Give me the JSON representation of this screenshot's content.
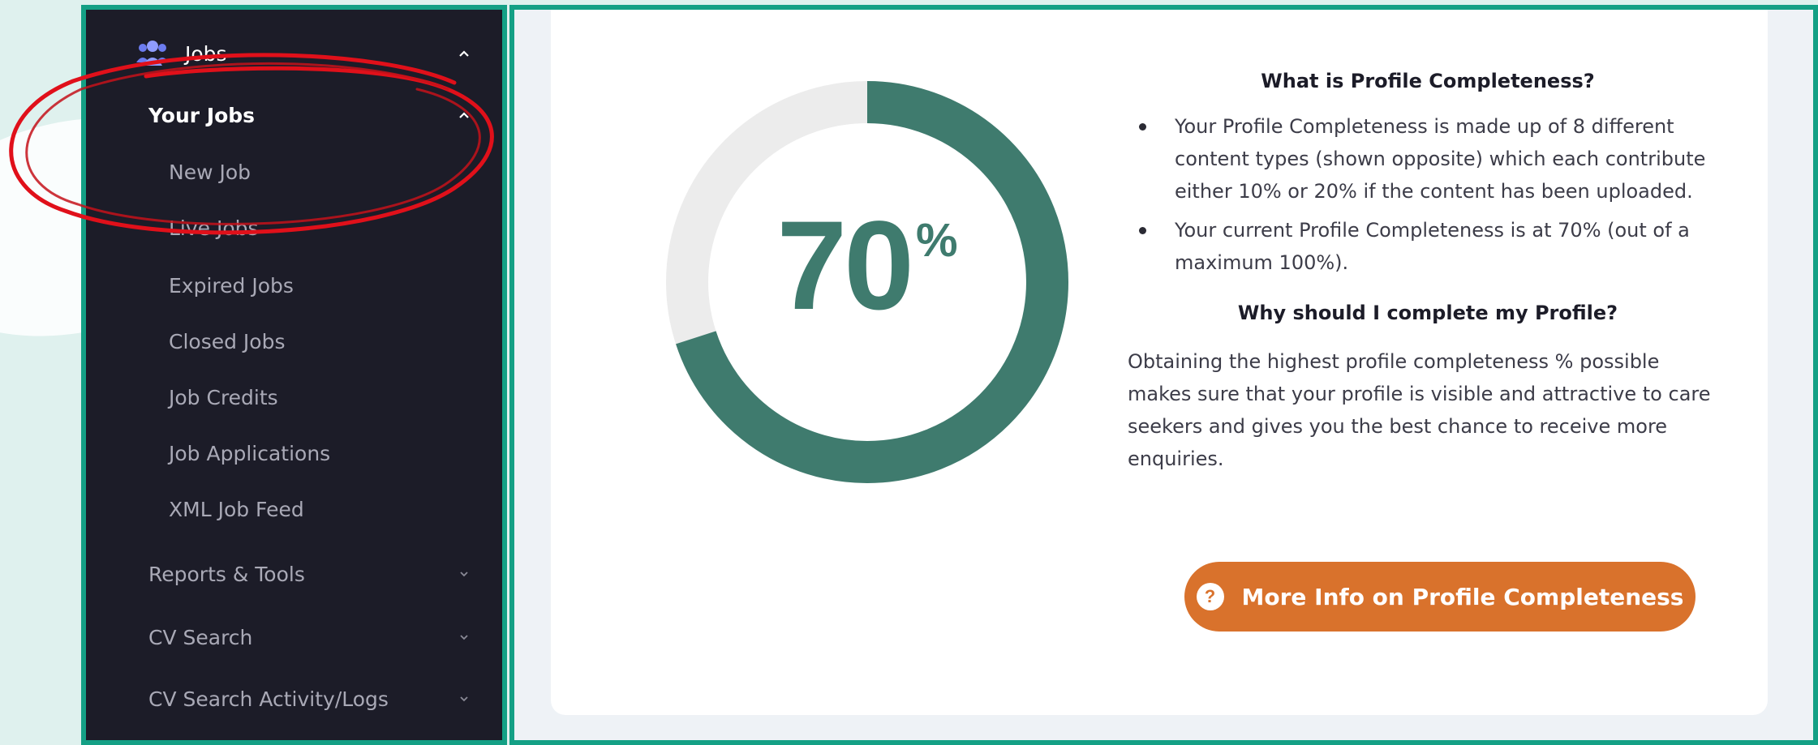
{
  "sidebar": {
    "section": {
      "label": "Jobs",
      "icon": "users-icon",
      "expanded": true
    },
    "items": [
      {
        "label": "Your Jobs",
        "level": "sub-parent",
        "active": true
      },
      {
        "label": "New Job"
      },
      {
        "label": "Live Jobs"
      },
      {
        "label": "Expired Jobs"
      },
      {
        "label": "Closed Jobs"
      },
      {
        "label": "Job Credits"
      },
      {
        "label": "Job Applications"
      },
      {
        "label": "XML Job Feed"
      }
    ],
    "groups": [
      {
        "label": "Reports & Tools"
      },
      {
        "label": "CV Search"
      },
      {
        "label": "CV Search Activity/Logs"
      }
    ]
  },
  "profile": {
    "completeness_value": "70",
    "completeness_unit": "%",
    "completeness_fraction": 0.7,
    "colors": {
      "progress": "#3f7b6e",
      "track": "#ececec",
      "button": "#d9722c"
    },
    "what_title": "What is Profile Completeness?",
    "bullets": [
      "Your Profile Completeness is made up of 8 different content types (shown opposite) which each contribute either 10% or 20% if the content has been uploaded.",
      "Your current Profile Completeness is at 70% (out of a maximum 100%)."
    ],
    "why_title": "Why should I complete my Profile?",
    "why_text": "Obtaining the highest profile completeness % possible makes sure that your profile is visible and attractive to care seekers and gives you the best chance to receive more enquiries.",
    "more_info_button": "More Info on Profile Completeness",
    "more_info_icon": "?"
  }
}
